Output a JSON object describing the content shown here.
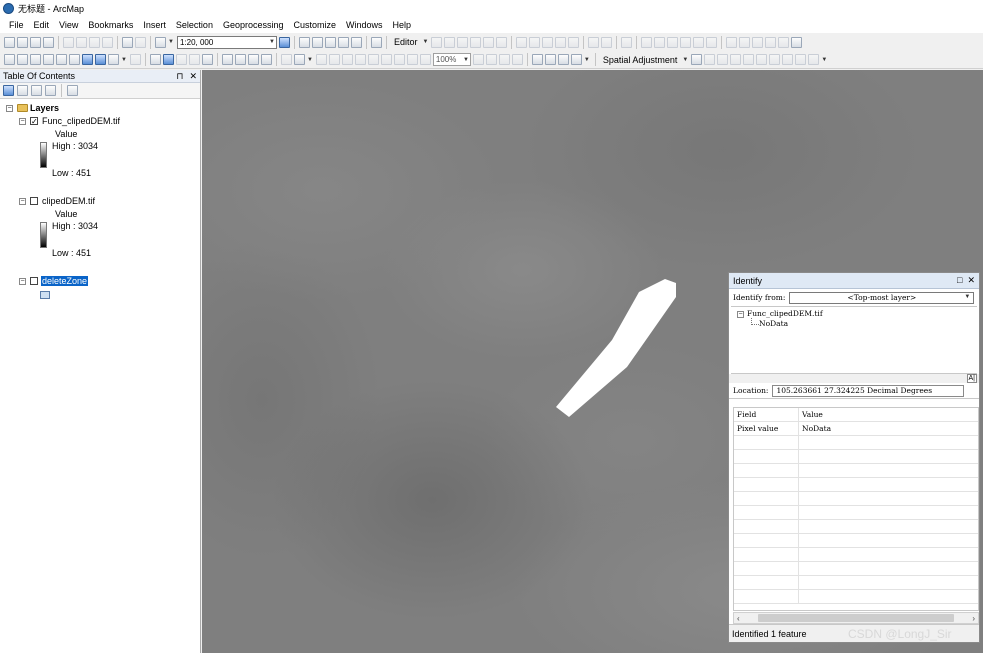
{
  "window": {
    "title": "无标题 - ArcMap"
  },
  "menu": [
    "File",
    "Edit",
    "View",
    "Bookmarks",
    "Insert",
    "Selection",
    "Geoprocessing",
    "Customize",
    "Windows",
    "Help"
  ],
  "toolbar": {
    "scale": "1:20, 000",
    "editor_label": "Editor",
    "zoom_percent": "100%",
    "spatial_adjustment_label": "Spatial Adjustment"
  },
  "toc": {
    "title": "Table Of Contents",
    "root": "Layers",
    "layers": [
      {
        "name": "Func_clipedDEM.tif",
        "checked": true,
        "legend_title": "Value",
        "high": "High : 3034",
        "low": "Low : 451"
      },
      {
        "name": "clipedDEM.tif",
        "checked": false,
        "legend_title": "Value",
        "high": "High : 3034",
        "low": "Low : 451"
      },
      {
        "name": "deleteZone",
        "checked": false
      }
    ]
  },
  "identify": {
    "title": "Identify",
    "from_label": "Identify from:",
    "from_value": "<Top-most layer>",
    "tree_layer": "Func_clipedDEM.tif",
    "tree_value": "NoData",
    "location_label": "Location:",
    "location_value": "105.263661  27.324225 Decimal Degrees",
    "field_header": "Field",
    "value_header": "Value",
    "rows": [
      {
        "field": "Pixel value",
        "value": "NoData"
      }
    ],
    "status": "Identified 1 feature"
  },
  "watermark": "CSDN @LongJ_Sir"
}
